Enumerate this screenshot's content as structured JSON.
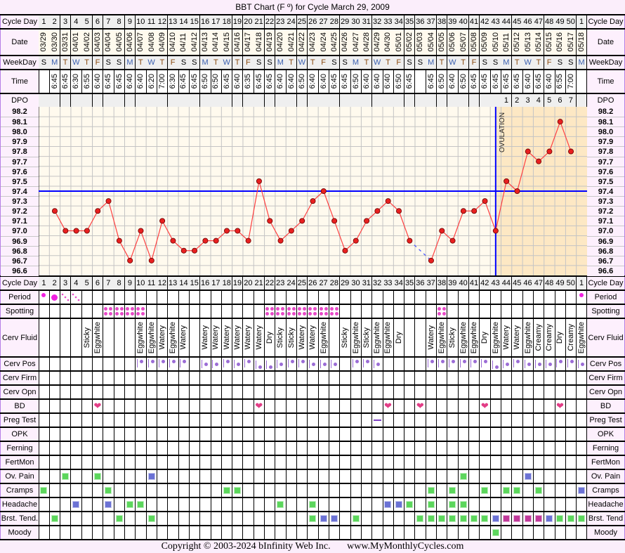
{
  "title": "BBT Chart (F º) for Cycle March 29, 2009",
  "labels": {
    "cycle_day": "Cycle Day",
    "date": "Date",
    "weekday": "WeekDay",
    "time": "Time",
    "dpo": "DPO",
    "period": "Period",
    "spotting": "Spotting",
    "cerv_fluid": "Cerv Fluid",
    "cerv_pos": "Cerv Pos",
    "cerv_firm": "Cerv Firm",
    "cerv_opn": "Cerv Opn",
    "bd": "BD",
    "preg_test": "Preg Test",
    "opk": "OPK",
    "ferning": "Ferning",
    "fertmon": "FertMon",
    "ov_pain": "Ov. Pain",
    "cramps": "Cramps",
    "headache": "Headache",
    "breast_tend": "Brst. Tend.",
    "moody": "Moody"
  },
  "right_labels": {
    "breast_tend": "Brst. Tend"
  },
  "colors": {
    "line": "#ff4040",
    "point": "#e82020",
    "coverline": "#0000ff",
    "ovulation": "#0000ff",
    "luteal_shade": "#fde8c4",
    "symptom_green": "#5cd65c",
    "symptom_blue": "#6b72d4",
    "symptom_magenta": "#c0399a"
  },
  "chart_data": {
    "type": "line",
    "title": "BBT Chart (F º) for Cycle March 29, 2009",
    "ylim": [
      96.6,
      98.2
    ],
    "yticks": [
      "98.2",
      "98.1",
      "98.0",
      "97.9",
      "97.8",
      "97.7",
      "97.6",
      "97.5",
      "97.4",
      "97.3",
      "97.2",
      "97.1",
      "97.0",
      "96.9",
      "96.8",
      "96.7",
      "96.6"
    ],
    "grid": true,
    "coverline": 97.4,
    "ovulation_day_index": 42,
    "ovulation_label": "OVULATION",
    "temps": [
      null,
      97.2,
      97.0,
      97.0,
      97.0,
      97.2,
      97.3,
      96.9,
      96.7,
      97.0,
      96.7,
      97.1,
      96.9,
      96.8,
      96.8,
      96.9,
      96.9,
      97.0,
      97.0,
      96.9,
      97.5,
      97.1,
      96.9,
      97.0,
      97.1,
      97.3,
      97.4,
      97.1,
      96.8,
      96.9,
      97.1,
      97.2,
      97.3,
      97.2,
      96.9,
      null,
      96.7,
      97.0,
      96.9,
      97.2,
      97.2,
      97.3,
      97.0,
      97.5,
      97.4,
      97.8,
      97.7,
      97.8,
      98.1,
      97.8,
      null
    ]
  },
  "cycle_day": [
    "1",
    "2",
    "3",
    "4",
    "5",
    "6",
    "7",
    "8",
    "9",
    "10",
    "11",
    "12",
    "13",
    "14",
    "15",
    "16",
    "17",
    "18",
    "19",
    "20",
    "21",
    "22",
    "23",
    "24",
    "25",
    "26",
    "27",
    "28",
    "29",
    "30",
    "31",
    "32",
    "33",
    "34",
    "35",
    "36",
    "37",
    "38",
    "39",
    "40",
    "41",
    "42",
    "43",
    "44",
    "45",
    "46",
    "47",
    "48",
    "49",
    "50",
    "1"
  ],
  "date": [
    "03/29",
    "03/30",
    "03/31",
    "04/01",
    "04/02",
    "04/03",
    "04/04",
    "04/05",
    "04/06",
    "04/07",
    "04/08",
    "04/09",
    "04/10",
    "04/11",
    "04/12",
    "04/13",
    "04/14",
    "04/15",
    "04/16",
    "04/17",
    "04/18",
    "04/19",
    "04/20",
    "04/21",
    "04/22",
    "04/23",
    "04/24",
    "04/25",
    "04/26",
    "04/27",
    "04/28",
    "04/29",
    "04/30",
    "05/01",
    "05/02",
    "05/03",
    "05/04",
    "05/05",
    "05/06",
    "05/07",
    "05/08",
    "05/09",
    "05/10",
    "05/11",
    "05/12",
    "05/13",
    "05/14",
    "05/15",
    "05/16",
    "05/17",
    "05/18"
  ],
  "weekday": [
    "S",
    "M",
    "T",
    "W",
    "T",
    "F",
    "S",
    "S",
    "M",
    "T",
    "W",
    "T",
    "F",
    "S",
    "S",
    "M",
    "T",
    "W",
    "T",
    "F",
    "S",
    "S",
    "M",
    "T",
    "W",
    "T",
    "F",
    "S",
    "S",
    "M",
    "T",
    "W",
    "T",
    "F",
    "S",
    "S",
    "M",
    "T",
    "W",
    "T",
    "F",
    "S",
    "S",
    "M",
    "T",
    "W",
    "T",
    "F",
    "S",
    "S",
    "M"
  ],
  "time": [
    "",
    "6:45",
    "6:45",
    "6:30",
    "6:55",
    "6:40",
    "6:45",
    "6:45",
    "6:40",
    "6:40",
    "6:20",
    "7:00",
    "6:30",
    "6:45",
    "6:45",
    "6:50",
    "6:50",
    "6:45",
    "6:40",
    "6:35",
    "6:45",
    "6:45",
    "6:40",
    "6:40",
    "6:50",
    "6:40",
    "6:40",
    "6:45",
    "6:45",
    "6:50",
    "6:40",
    "6:40",
    "6:40",
    "6:50",
    "6:45",
    "",
    "6:45",
    "6:50",
    "6:40",
    "6:50",
    "6:45",
    "6:45",
    "6:45",
    "6:45",
    "6:45",
    "6:40",
    "6:45",
    "6:40",
    "6:55",
    "7:00",
    ""
  ],
  "dpo": [
    "",
    "",
    "",
    "",
    "",
    "",
    "",
    "",
    "",
    "",
    "",
    "",
    "",
    "",
    "",
    "",
    "",
    "",
    "",
    "",
    "",
    "",
    "",
    "",
    "",
    "",
    "",
    "",
    "",
    "",
    "",
    "",
    "",
    "",
    "",
    "",
    "",
    "",
    "",
    "",
    "",
    "",
    "",
    "1",
    "2",
    "3",
    "4",
    "5",
    "6",
    "7",
    ""
  ],
  "period": [
    "light",
    "heavy",
    "spotting",
    "spotting",
    null,
    null,
    null,
    null,
    null,
    null,
    null,
    null,
    null,
    null,
    null,
    null,
    null,
    null,
    null,
    null,
    null,
    null,
    null,
    null,
    null,
    null,
    null,
    null,
    null,
    null,
    null,
    null,
    null,
    null,
    null,
    null,
    null,
    null,
    null,
    null,
    null,
    null,
    null,
    null,
    null,
    null,
    null,
    null,
    null,
    null,
    "light"
  ],
  "spotting": [
    6,
    7,
    8,
    9,
    21,
    22,
    23,
    24,
    25,
    26,
    27,
    37
  ],
  "cerv_fluid": [
    "",
    "",
    "",
    "",
    "Sticky",
    "Eggwhite",
    "",
    "",
    "",
    "Eggwhite",
    "Eggwhite",
    "Watery",
    "Eggwhite",
    "Watery",
    "",
    "Watery",
    "Watery",
    "Watery",
    "Watery",
    "Watery",
    "Watery",
    "Dry",
    "Sticky",
    "Sticky",
    "Watery",
    "Watery",
    "Eggwhite",
    "",
    "Sticky",
    "Eggwhite",
    "Sticky",
    "Eggwhite",
    "Eggwhite",
    "Dry",
    "",
    "",
    "Watery",
    "Eggwhite",
    "Sticky",
    "Eggwhite",
    "Eggwhite",
    "Dry",
    "Eggwhite",
    "Watery",
    "Watery",
    "Eggwhite",
    "Creamy",
    "Creamy",
    "Dry",
    "Creamy",
    "Eggwhite"
  ],
  "cerv_pos": [
    null,
    null,
    null,
    null,
    null,
    null,
    null,
    null,
    null,
    "high",
    "high",
    "high",
    "high",
    "high",
    null,
    "mid",
    "mid",
    "high",
    "mid",
    "high",
    "low",
    "low",
    "mid",
    "high",
    "high",
    "mid",
    "mid",
    "mid",
    null,
    "high",
    "high",
    "mid",
    null,
    null,
    null,
    null,
    "high",
    "high",
    "high",
    "high",
    "high",
    "high",
    "low",
    "mid",
    "high",
    "mid",
    "mid",
    "mid",
    "high",
    "high",
    "mid"
  ],
  "bd": [
    5,
    20,
    32,
    35,
    41,
    48
  ],
  "preg_test": [
    31
  ],
  "symptoms": {
    "ov_pain": {
      "2": "green",
      "5": "green",
      "10": "blue",
      "39": "green",
      "45": "blue"
    },
    "cramps": {
      "0": "green",
      "6": "green",
      "17": "green",
      "18": "green",
      "36": "green",
      "38": "green",
      "41": "green",
      "43": "green",
      "44": "green",
      "46": "green",
      "50": "blue"
    },
    "headache": {
      "3": "blue",
      "6": "blue",
      "8": "green",
      "9": "green",
      "22": "green",
      "25": "green",
      "32": "blue",
      "33": "blue",
      "34": "green",
      "36": "green",
      "38": "green",
      "39": "green"
    },
    "breast_tend": {
      "1": "green",
      "7": "green",
      "10": "green",
      "25": "green",
      "26": "blue",
      "27": "blue",
      "29": "green",
      "35": "green",
      "36": "green",
      "37": "green",
      "38": "green",
      "39": "green",
      "40": "green",
      "41": "green",
      "42": "blue",
      "43": "magenta",
      "44": "magenta",
      "45": "magenta",
      "46": "magenta",
      "47": "blue",
      "48": "green",
      "49": "green",
      "50": "green"
    },
    "moody": {
      "42": "green"
    }
  },
  "footer": {
    "copyright": "Copyright © 2003-2024 bInfinity Web Inc.",
    "site": "www.MyMonthlyCycles.com"
  }
}
